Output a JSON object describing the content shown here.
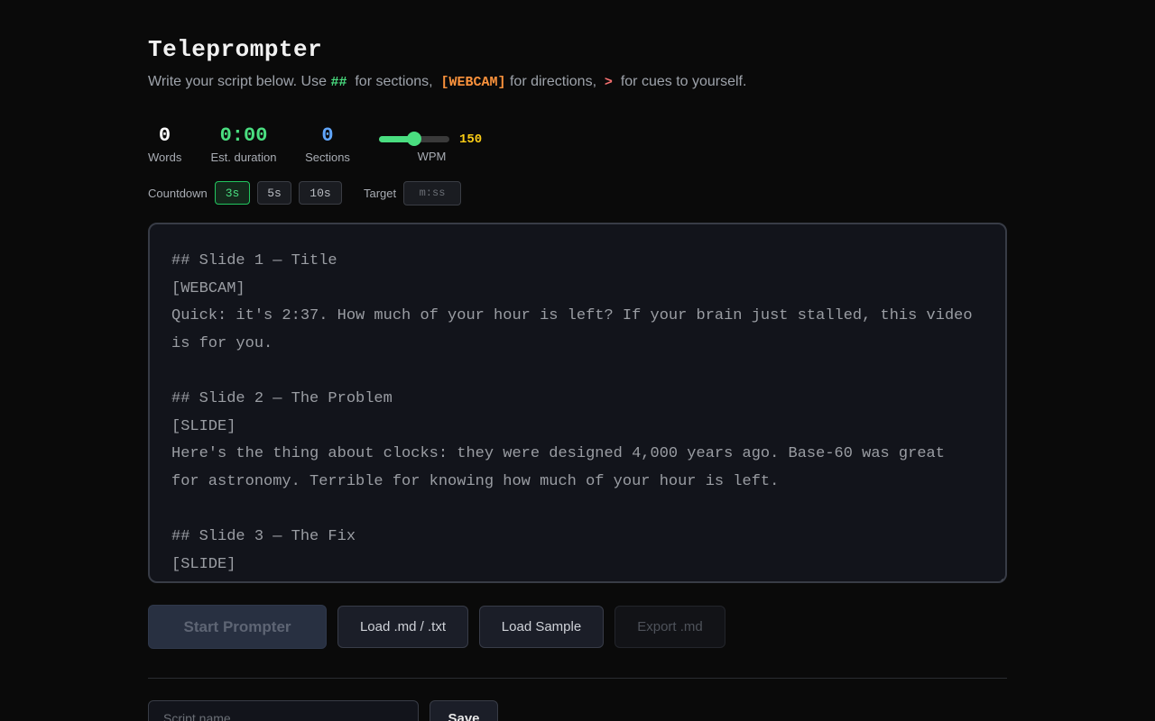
{
  "app": {
    "title": "Teleprompter",
    "subtitle": {
      "part1": "Write your script below. Use",
      "code_sections": "##",
      "part2": "for sections,",
      "code_directions": "[WEBCAM]",
      "part3": "for directions,",
      "code_cues": ">",
      "part4": "for cues to yourself."
    }
  },
  "stats": {
    "words": {
      "value": "0",
      "label": "Words"
    },
    "duration": {
      "value": "0:00",
      "label": "Est. duration"
    },
    "sections": {
      "value": "0",
      "label": "Sections"
    },
    "wpm": {
      "value": "150",
      "label": "WPM",
      "slider_fraction": 0.5
    }
  },
  "countdown": {
    "label": "Countdown",
    "options": [
      "3s",
      "5s",
      "10s"
    ],
    "selected": "3s"
  },
  "target": {
    "label": "Target",
    "placeholder": "m:ss"
  },
  "editor": {
    "placeholder": "## Slide 1 — Title\n[WEBCAM]\nQuick: it's 2:37. How much of your hour is left? If your brain just stalled, this video is for you.\n\n## Slide 2 — The Problem\n[SLIDE]\nHere's the thing about clocks: they were designed 4,000 years ago. Base-60 was great for astronomy. Terrible for knowing how much of your hour is left.\n\n## Slide 3 — The Fix\n[SLIDE]"
  },
  "actions": {
    "start": "Start Prompter",
    "load_file": "Load .md / .txt",
    "load_sample": "Load Sample",
    "export": "Export .md"
  },
  "save_row": {
    "name_placeholder": "Script name",
    "save": "Save"
  },
  "colors": {
    "background": "#0a0a0a",
    "accent_green": "#4ade80",
    "accent_blue": "#60a5fa",
    "accent_yellow": "#facc15",
    "accent_orange": "#fb923c",
    "accent_red": "#f87171"
  }
}
